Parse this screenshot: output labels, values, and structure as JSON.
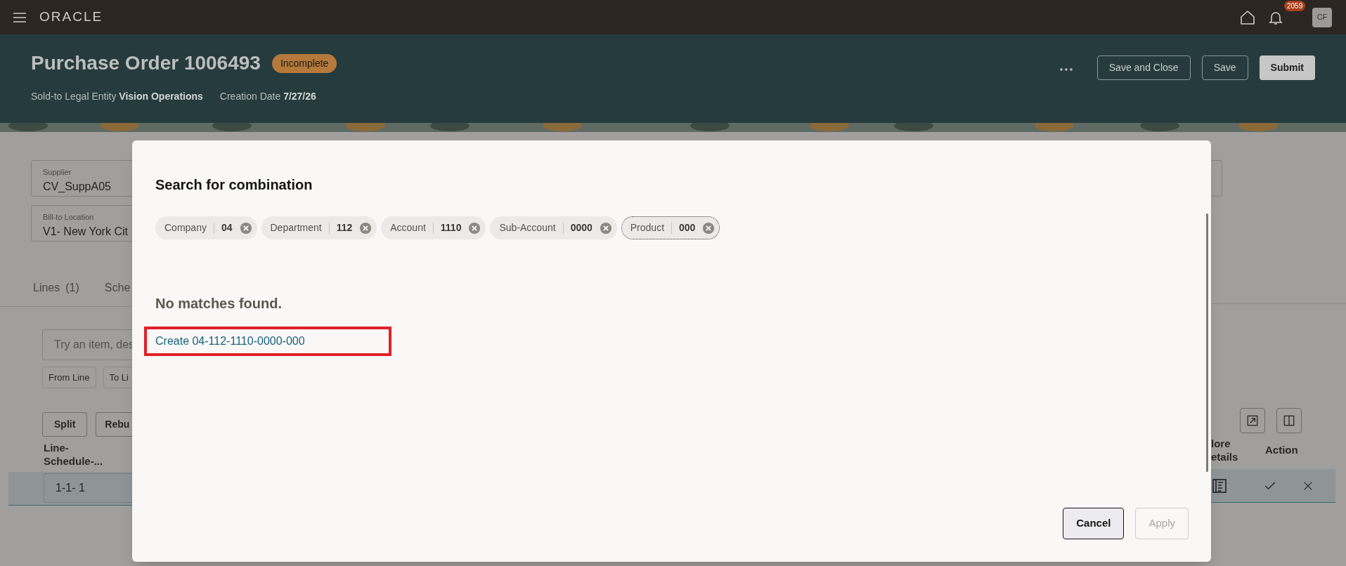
{
  "top_bar": {
    "logo": "ORACLE",
    "notification_count": "2059",
    "avatar": "CF"
  },
  "header": {
    "title": "Purchase Order 1006493",
    "status": "Incomplete",
    "facts": [
      {
        "label": "Sold-to Legal Entity",
        "value": "Vision Operations"
      },
      {
        "label": "Creation Date",
        "value": "7/27/26"
      }
    ],
    "actions": [
      {
        "label": "Save and Close",
        "kind": "secondary"
      },
      {
        "label": "Save",
        "kind": "secondary"
      },
      {
        "label": "Submit",
        "kind": "primary"
      }
    ]
  },
  "form": {
    "fields": [
      {
        "label": "Supplier",
        "value": "CV_SuppA05"
      },
      {
        "label": "Bill-to Location",
        "value": "V1- New York Cit"
      }
    ],
    "tabs": [
      {
        "label": "Lines",
        "count": "(1)"
      },
      {
        "label": "Sche"
      }
    ],
    "search": {
      "placeholder": "Try an item, des"
    },
    "filters": [
      "From Line",
      "To Li"
    ],
    "buttons": [
      "Split",
      "Rebu"
    ],
    "columns": [
      "Line-Schedule-...",
      "lore etails",
      "Action"
    ],
    "row": {
      "cell": "1-1- 1"
    }
  },
  "dialog": {
    "title": "Search for combination",
    "chips": [
      {
        "label": "Company",
        "value": "04",
        "focused": false
      },
      {
        "label": "Department",
        "value": "112",
        "focused": false
      },
      {
        "label": "Account",
        "value": "1110",
        "focused": false
      },
      {
        "label": "Sub-Account",
        "value": "0000",
        "focused": false
      },
      {
        "label": "Product",
        "value": "000",
        "focused": true
      }
    ],
    "message": "No matches found.",
    "create_link": "Create 04-112-1110-0000-000",
    "buttons": [
      {
        "label": "Cancel",
        "disabled": false
      },
      {
        "label": "Apply",
        "disabled": true
      }
    ]
  }
}
